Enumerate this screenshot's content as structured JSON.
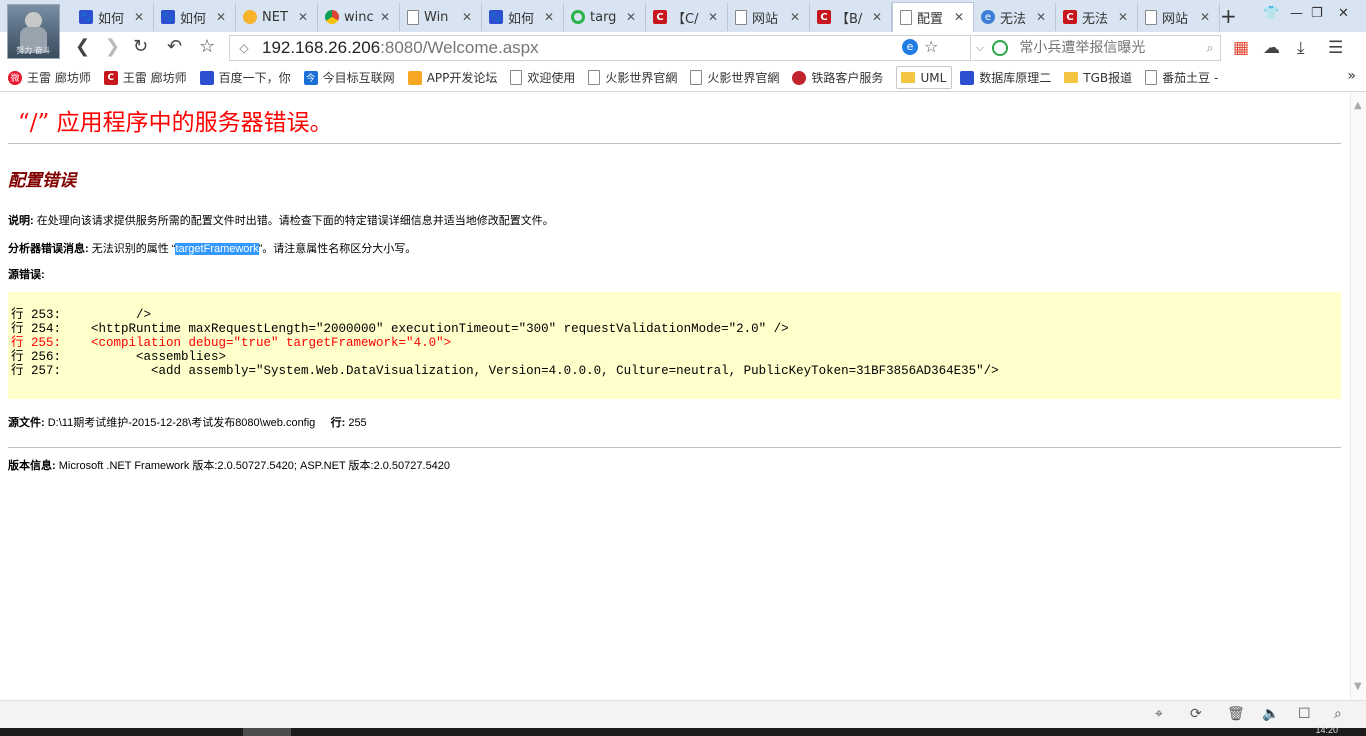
{
  "browser": {
    "avatar_caption": "努力 奋斗",
    "tabs": [
      {
        "title": "如何",
        "icon": "paw-icon"
      },
      {
        "title": "如何",
        "icon": "paw-icon"
      },
      {
        "title": "NET",
        "icon": "flame-icon"
      },
      {
        "title": "winc",
        "icon": "chrome-icon"
      },
      {
        "title": "Win",
        "icon": "doc-icon"
      },
      {
        "title": "如何",
        "icon": "paw-icon"
      },
      {
        "title": "targ",
        "icon": "360search-icon"
      },
      {
        "title": "【C/",
        "icon": "csdn-icon"
      },
      {
        "title": "网站",
        "icon": "doc-icon"
      },
      {
        "title": "【B/",
        "icon": "csdn-icon"
      },
      {
        "title": "配置",
        "icon": "doc-icon",
        "active": true
      },
      {
        "title": "无法",
        "icon": "ie-icon"
      },
      {
        "title": "无法",
        "icon": "csdn-icon"
      },
      {
        "title": "网站",
        "icon": "doc-icon"
      }
    ],
    "new_tab": "+",
    "url_host": "192.168.26.206",
    "url_rest": ":8080/Welcome.aspx",
    "search_placeholder": "常小兵遭举报信曝光",
    "bookmarks": [
      {
        "label": "王雷 廊坊师",
        "icon": "weibo-icon"
      },
      {
        "label": "王雷 廊坊师",
        "icon": "csdn-icon"
      },
      {
        "label": "百度一下，你",
        "icon": "paw-icon"
      },
      {
        "label": "今目标互联网",
        "icon": "jingoal-icon"
      },
      {
        "label": "APP开发论坛",
        "icon": "app-icon"
      },
      {
        "label": "欢迎使用",
        "icon": "doc-icon"
      },
      {
        "label": "火影世界官網",
        "icon": "doc-icon"
      },
      {
        "label": "火影世界官網",
        "icon": "doc-icon"
      },
      {
        "label": "铁路客户服务",
        "icon": "rail-icon"
      },
      {
        "label": "UML",
        "icon": "folder-icon",
        "boxed": true
      },
      {
        "label": "数据库原理二",
        "icon": "paw-icon"
      },
      {
        "label": "TGB报道",
        "icon": "folder-icon"
      },
      {
        "label": "番茄土豆 -",
        "icon": "doc-icon"
      }
    ],
    "more": "»",
    "clock": "14:20"
  },
  "error_page": {
    "title": "“/” 应用程序中的服务器错误。",
    "subtitle": "配置错误",
    "desc_label": "说明:",
    "desc_text": " 在处理向该请求提供服务所需的配置文件时出错。请检查下面的特定错误详细信息并适当地修改配置文件。",
    "parser_label": "分析器错误消息:",
    "parser_text_before": " 无法识别的属性 “",
    "parser_highlight": "targetFramework",
    "parser_text_after": "”。请注意属性名称区分大小写。",
    "source_label": "源错误:",
    "code_lines": [
      {
        "text": "行 253:          />",
        "error": false
      },
      {
        "text": "行 254:    <httpRuntime maxRequestLength=\"2000000\" executionTimeout=\"300\" requestValidationMode=\"2.0\" />",
        "error": false
      },
      {
        "text": "行 255:    <compilation debug=\"true\" targetFramework=\"4.0\">",
        "error": true
      },
      {
        "text": "行 256:          <assemblies>",
        "error": false
      },
      {
        "text": "行 257:            <add assembly=\"System.Web.DataVisualization, Version=4.0.0.0, Culture=neutral, PublicKeyToken=31BF3856AD364E35\"/>",
        "error": false
      }
    ],
    "source_file_label": "源文件:",
    "source_file_value": " D:\\11期考试维护-2015-12-28\\考试发布8080\\web.config",
    "line_label": "行:",
    "line_value": " 255",
    "version_label": "版本信息:",
    "version_value": " Microsoft .NET Framework 版本:2.0.50727.5420; ASP.NET 版本:2.0.50727.5420"
  },
  "colors": {
    "title_red": "#ff0000",
    "subtitle_maroon": "#800000",
    "code_bg": "#ffffcc",
    "highlight": "#3399ff"
  }
}
